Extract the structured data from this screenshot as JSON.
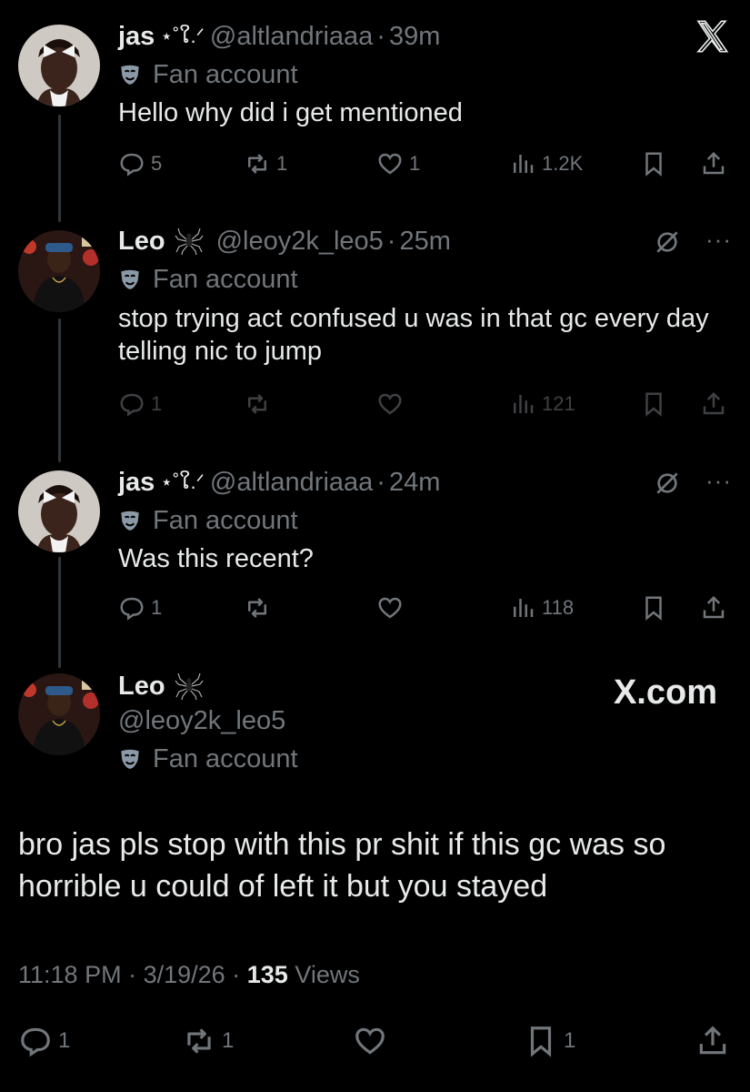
{
  "tweets": [
    {
      "name": "jas",
      "name_deco": "⋆˚ໃ.ᐟ",
      "handle": "@altlandriaaa",
      "time": "39m",
      "badge": "Fan account",
      "text": "Hello why did i get mentioned",
      "replies": "5",
      "reposts": "1",
      "likes": "1",
      "views": "1.2K"
    },
    {
      "name": "Leo",
      "handle": "@leoy2k_leo5",
      "time": "25m",
      "badge": "Fan account",
      "text": "stop trying act confused u was in that gc every day telling nic to jump",
      "replies": "1",
      "reposts": "",
      "likes": "",
      "views": "121",
      "more": "···"
    },
    {
      "name": "jas",
      "name_deco": "⋆˚ໃ.ᐟ",
      "handle": "@altlandriaaa",
      "time": "24m",
      "badge": "Fan account",
      "text": "Was this recent?",
      "replies": "1",
      "reposts": "",
      "likes": "",
      "views": "118",
      "more": "···"
    }
  ],
  "main_tweet": {
    "name": "Leo",
    "handle": "@leoy2k_leo5",
    "badge": "Fan account",
    "text": "bro jas pls stop with this pr shit if this gc was so horrible u could of left it but you stayed",
    "time": "11:18 PM",
    "date": "3/19/26",
    "views_count": "135",
    "views_label": "Views",
    "replies": "1",
    "reposts": "1",
    "likes": "",
    "bookmarks": "1"
  },
  "watermark": "X.com",
  "separator": "·",
  "icons": [
    "x-logo-icon",
    "reply-icon",
    "repost-icon",
    "like-icon",
    "views-icon",
    "bookmark-icon",
    "share-icon",
    "grok-icon",
    "mask-icon",
    "spider-icon"
  ],
  "colors": {
    "background": "#000000",
    "text": "#e7e9ea",
    "muted": "#71767b",
    "line": "#333639"
  }
}
